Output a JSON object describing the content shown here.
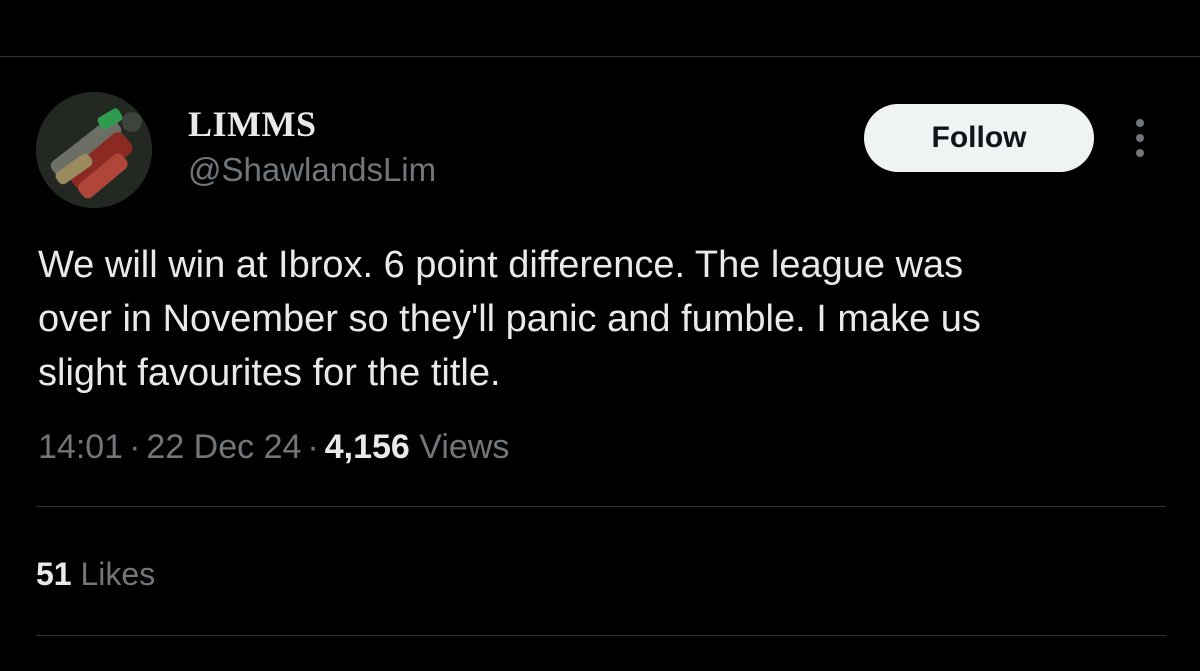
{
  "author": {
    "display_name": "LIMMS",
    "handle": "@ShawlandsLim",
    "avatar_icon": "profile-photo-avatar"
  },
  "actions": {
    "follow_label": "Follow",
    "more_icon": "more-vertical-icon"
  },
  "tweet": {
    "lines": [
      "We will win at Ibrox. 6 point difference. The league was",
      "over in November so they'll panic and fumble. I make us",
      "slight favourites for the title."
    ]
  },
  "meta": {
    "time": "14:01",
    "separator": "·",
    "date": "22 Dec 24",
    "views_count": "4,156",
    "views_label": "Views"
  },
  "stats": {
    "likes_count": "51",
    "likes_label": "Likes"
  },
  "colors": {
    "background": "#000000",
    "primary_text": "#e7e9ea",
    "secondary_text": "#71767b",
    "divider": "#2f3336",
    "follow_button_bg": "#eff3f4"
  }
}
